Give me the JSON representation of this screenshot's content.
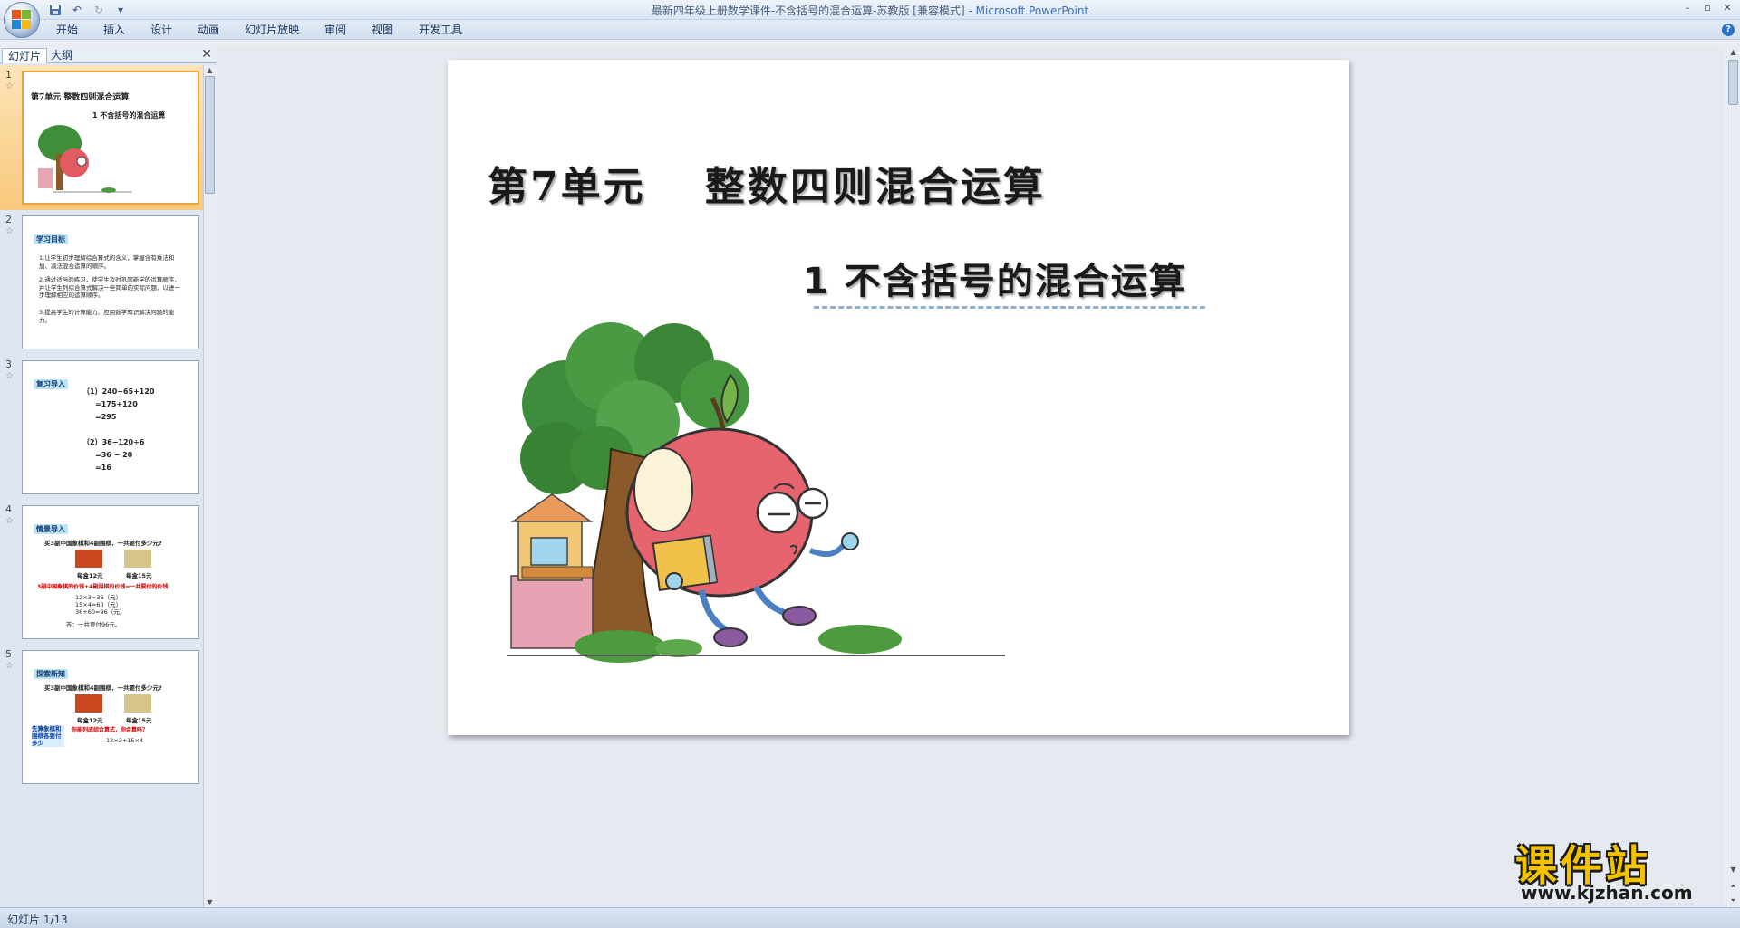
{
  "window": {
    "title": "最新四年级上册数学课件-不含括号的混合运算-苏教版 [兼容模式]",
    "app_name": "Microsoft PowerPoint",
    "controls": [
      "–",
      "▫",
      "✕"
    ]
  },
  "qat": {
    "save_icon": "save-icon",
    "undo_icon": "undo-icon",
    "redo_icon": "redo-icon"
  },
  "ribbon": {
    "tabs": [
      "开始",
      "插入",
      "设计",
      "动画",
      "幻灯片放映",
      "审阅",
      "视图",
      "开发工具"
    ],
    "help": "?"
  },
  "left_pane": {
    "tabs": [
      "幻灯片",
      "大纲"
    ],
    "close": "✕",
    "slides": [
      {
        "number": "1",
        "title": "第7单元   整数四则混合运算",
        "subtitle": "1  不含括号的混合运算"
      },
      {
        "number": "2",
        "tag": "学习目标",
        "lines": [
          "1.让学生初步理解综合算式的含义，掌握含有乘法和加、减法混合运算的顺序。",
          "2.通过适当的练习，使学生及时巩固新学的运算顺序，并让学生列综合算式解决一些简单的实际问题，以进一步理解相应的运算顺序。",
          "3.提高学生的计算能力、应用数学知识解决问题的能力。"
        ]
      },
      {
        "number": "3",
        "tag": "复习导入",
        "math": [
          "（1）240−65+120",
          "=175+120",
          "=295",
          "（2）36−120÷6",
          "=36 − 20",
          "=16"
        ]
      },
      {
        "number": "4",
        "tag": "情景导入",
        "question": "买3副中国象棋和4副围棋，一共要付多少元?",
        "price_a": "每盒12元",
        "price_b": "每盒15元",
        "note": "3副中国象棋的价钱+4副围棋的价钱=一共要付的价钱",
        "calc": [
          "12×3=36（元）",
          "15×4=60（元）",
          "36+60=96（元）"
        ],
        "answer": "答：一共要付96元。"
      },
      {
        "number": "5",
        "tag": "探索新知",
        "question": "买3副中国象棋和4副围棋，一共要付多少元?",
        "price_a": "每盒12元",
        "price_b": "每盒15元",
        "side_note": "先算象棋和围棋各要付多少",
        "red_note": "你能列成综合算式，你会算吗？",
        "calc": "12×3+15×4"
      }
    ]
  },
  "slide": {
    "title": "第7单元　 整数四则混合运算",
    "subtitle": "1  不含括号的混合运算"
  },
  "watermark": {
    "title": "课件站",
    "url": "www.kjzhan.com"
  },
  "status": {
    "text": "幻灯片 1/13"
  }
}
